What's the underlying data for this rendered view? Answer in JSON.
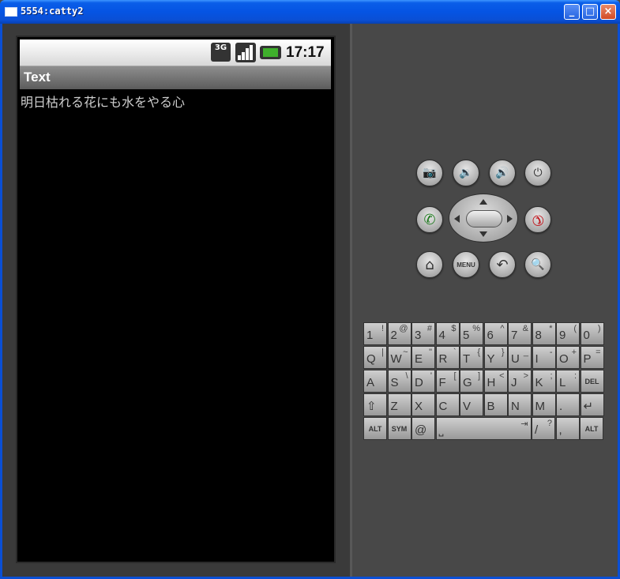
{
  "window": {
    "title": "5554:catty2",
    "min_glyph": "_",
    "max_glyph": "□",
    "close_glyph": "×"
  },
  "status_bar": {
    "network": "3G",
    "time": "17:17"
  },
  "app": {
    "title": "Text",
    "body_text": "明日枯れる花にも水をやる心"
  },
  "controls": {
    "camera": "📷",
    "volume_down": "🔉",
    "volume_up": "🔊",
    "power": "⏻",
    "call": "✆",
    "end_call": "✆",
    "home": "⌂",
    "menu": "MENU",
    "back": "↶",
    "search": "🔍"
  },
  "keyboard": {
    "row1": [
      {
        "main": "1",
        "alt": "!"
      },
      {
        "main": "2",
        "alt": "@"
      },
      {
        "main": "3",
        "alt": "#"
      },
      {
        "main": "4",
        "alt": "$"
      },
      {
        "main": "5",
        "alt": "%"
      },
      {
        "main": "6",
        "alt": "^"
      },
      {
        "main": "7",
        "alt": "&"
      },
      {
        "main": "8",
        "alt": "*"
      },
      {
        "main": "9",
        "alt": "("
      },
      {
        "main": "0",
        "alt": ")"
      }
    ],
    "row2": [
      {
        "main": "Q",
        "alt": "|"
      },
      {
        "main": "W",
        "alt": "~"
      },
      {
        "main": "E",
        "alt": "\""
      },
      {
        "main": "R",
        "alt": "`"
      },
      {
        "main": "T",
        "alt": "{"
      },
      {
        "main": "Y",
        "alt": "}"
      },
      {
        "main": "U",
        "alt": "_"
      },
      {
        "main": "I",
        "alt": "-"
      },
      {
        "main": "O",
        "alt": "+"
      },
      {
        "main": "P",
        "alt": "="
      }
    ],
    "row3": [
      {
        "main": "A",
        "alt": ""
      },
      {
        "main": "S",
        "alt": "\\"
      },
      {
        "main": "D",
        "alt": "'"
      },
      {
        "main": "F",
        "alt": "["
      },
      {
        "main": "G",
        "alt": "]"
      },
      {
        "main": "H",
        "alt": "<"
      },
      {
        "main": "J",
        "alt": ">"
      },
      {
        "main": "K",
        "alt": ";"
      },
      {
        "main": "L",
        "alt": ":"
      },
      {
        "main": "DEL",
        "alt": ""
      }
    ],
    "row4": [
      {
        "main": "⇧",
        "alt": ""
      },
      {
        "main": "Z",
        "alt": ""
      },
      {
        "main": "X",
        "alt": ""
      },
      {
        "main": "C",
        "alt": ""
      },
      {
        "main": "V",
        "alt": ""
      },
      {
        "main": "B",
        "alt": ""
      },
      {
        "main": "N",
        "alt": ""
      },
      {
        "main": "M",
        "alt": ""
      },
      {
        "main": ".",
        "alt": ""
      },
      {
        "main": "↵",
        "alt": ""
      }
    ],
    "row5": [
      {
        "main": "ALT",
        "alt": ""
      },
      {
        "main": "SYM",
        "alt": ""
      },
      {
        "main": "@",
        "alt": ""
      },
      {
        "main": "⎵",
        "alt": "⇥"
      },
      {
        "main": "/",
        "alt": "?"
      },
      {
        "main": ",",
        "alt": ""
      },
      {
        "main": "ALT",
        "alt": ""
      }
    ]
  }
}
